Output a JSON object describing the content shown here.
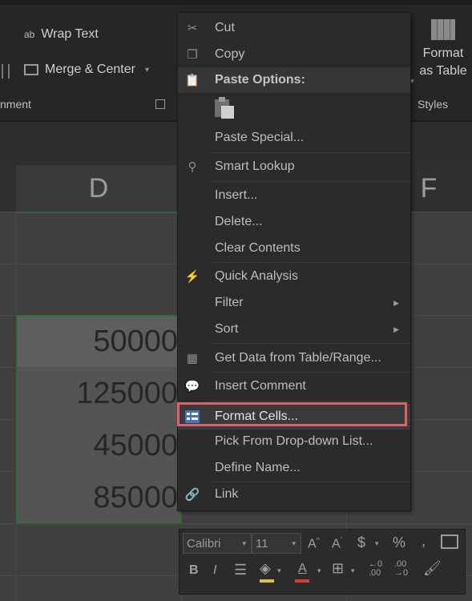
{
  "ribbon": {
    "wrap_text": "Wrap Text",
    "wrap_icon": "ab",
    "merge_center": "Merge & Center",
    "alignment_group": "nment",
    "format_table": "Format as Table",
    "styles_group": "Styles"
  },
  "columns": {
    "d": "D",
    "f": "F"
  },
  "cells": [
    "50000",
    "125000",
    "45000",
    "85000"
  ],
  "context_menu": {
    "cut": "Cut",
    "copy": "Copy",
    "paste_options": "Paste Options:",
    "paste_special": "Paste Special...",
    "smart_lookup": "Smart Lookup",
    "insert": "Insert...",
    "delete": "Delete...",
    "clear_contents": "Clear Contents",
    "quick_analysis": "Quick Analysis",
    "filter": "Filter",
    "sort": "Sort",
    "get_data": "Get Data from Table/Range...",
    "insert_comment": "Insert Comment",
    "format_cells": "Format Cells...",
    "pick_dropdown": "Pick From Drop-down List...",
    "define_name": "Define Name...",
    "link": "Link"
  },
  "mini_toolbar": {
    "font": "Calibri",
    "size": "11",
    "currency": "$",
    "percent": "%",
    "comma": ",",
    "bold": "B",
    "italic": "I"
  },
  "highlight_color": "#d9636b"
}
